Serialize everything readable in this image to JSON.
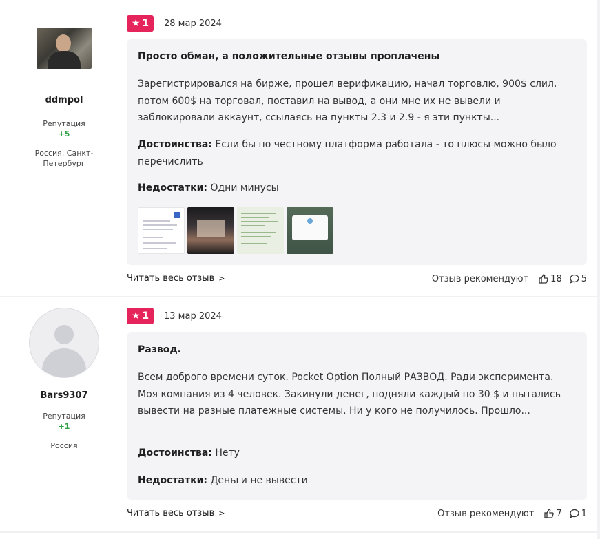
{
  "reviews": [
    {
      "user": {
        "name": "ddmpol",
        "reputation_label": "Репутация",
        "reputation_value": "+5",
        "location": "Россия, Санкт-Петербург"
      },
      "rating": "1",
      "date": "28 мар 2024",
      "title": "Просто обман, а положительные отзывы проплачены",
      "body": "Зарегистрировался на бирже, прошел верификацию, начал торговлю, 900$ слил, потом 600$ на торговал, поставил на вывод, а они мне их не вывели и заблокировали аккаунт, ссылаясь на пункты 2.3 и 2.9 - я эти пункты...",
      "pros_label": "Достоинства:",
      "pros": "Если бы по честному платформа работала - то плюсы можно было перечислить",
      "cons_label": "Недостатки:",
      "cons": "Одни минусы",
      "read_more": "Читать весь отзыв",
      "recommend_label": "Отзыв рекомендуют",
      "likes": "18",
      "comments": "5"
    },
    {
      "user": {
        "name": "Bars9307",
        "reputation_label": "Репутация",
        "reputation_value": "+1",
        "location": "Россия"
      },
      "rating": "1",
      "date": "13 мар 2024",
      "title": "Развод.",
      "body": "Всем доброго времени суток. Pocket Option Полный РАЗВОД. Ради эксперимента. Моя компания из 4 человек. Закинули денег, подняли каждый по 30 $ и пытались вывести на разные платежные системы. Ни у кого не получилось. Прошло...",
      "pros_label": "Достоинства:",
      "pros": "Нету",
      "cons_label": "Недостатки:",
      "cons": "Деньги не вывести",
      "read_more": "Читать весь отзыв",
      "recommend_label": "Отзыв рекомендуют",
      "likes": "7",
      "comments": "1"
    }
  ],
  "colors": {
    "rating_badge": "#e5245c",
    "reputation": "#2ea043",
    "card_bg": "#f4f4f6"
  },
  "icons": {
    "rating": "star-icon",
    "read_more": "chevron-right-icon",
    "likes": "thumbs-up-icon",
    "comments": "comment-icon"
  }
}
